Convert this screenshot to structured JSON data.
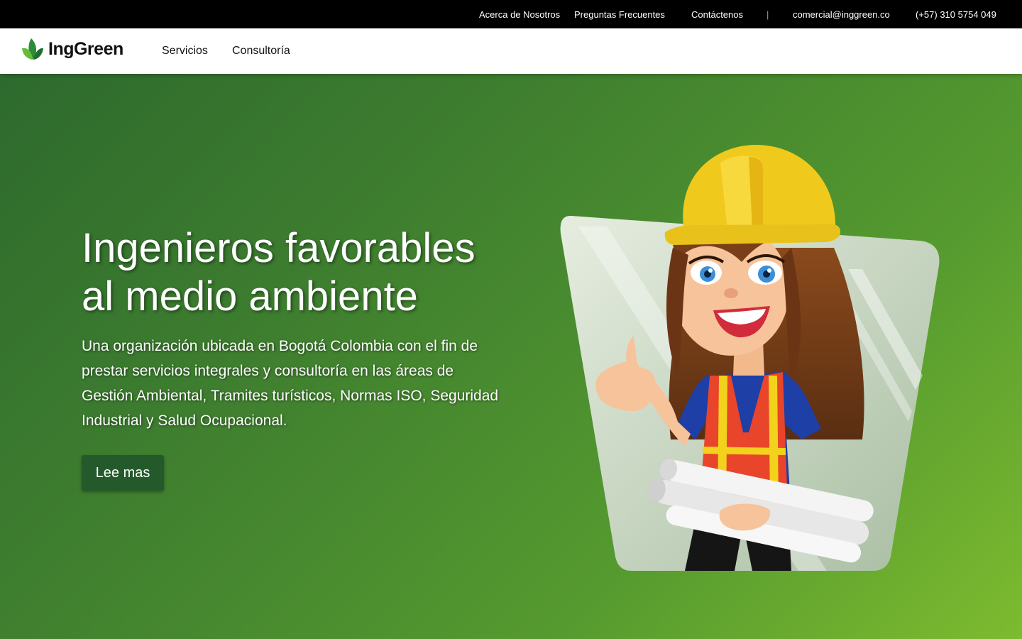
{
  "topbar": {
    "links": [
      "Acerca de Nosotros",
      "Preguntas Frecuentes",
      "Contáctenos"
    ],
    "separator": "|",
    "email": "comercial@inggreen.co",
    "phone": "(+57) 310 5754 049"
  },
  "navbar": {
    "logo_text": "IngGreen",
    "logo_icon": "leaf-icon",
    "items": [
      "Servicios",
      "Consultoría"
    ]
  },
  "hero": {
    "title_line1": "Ingenieros favorables",
    "title_line2": "al medio ambiente",
    "description": "Una organización ubicada en Bogotá Colombia con el fin de prestar servicios integrales y consultoría en las áreas de Gestión Ambiental, Tramites turísticos, Normas ISO, Seguridad Industrial y Salud Ocupacional.",
    "button_label": "Lee mas",
    "illustration": "engineer-woman-illustration"
  },
  "colors": {
    "topbar_bg": "#000000",
    "navbar_bg": "#ffffff",
    "hero_gradient_start": "#2d6a2e",
    "hero_gradient_end": "#7dbb2f",
    "button_bg": "#245a2b",
    "brand_green": "#4caf3a"
  }
}
